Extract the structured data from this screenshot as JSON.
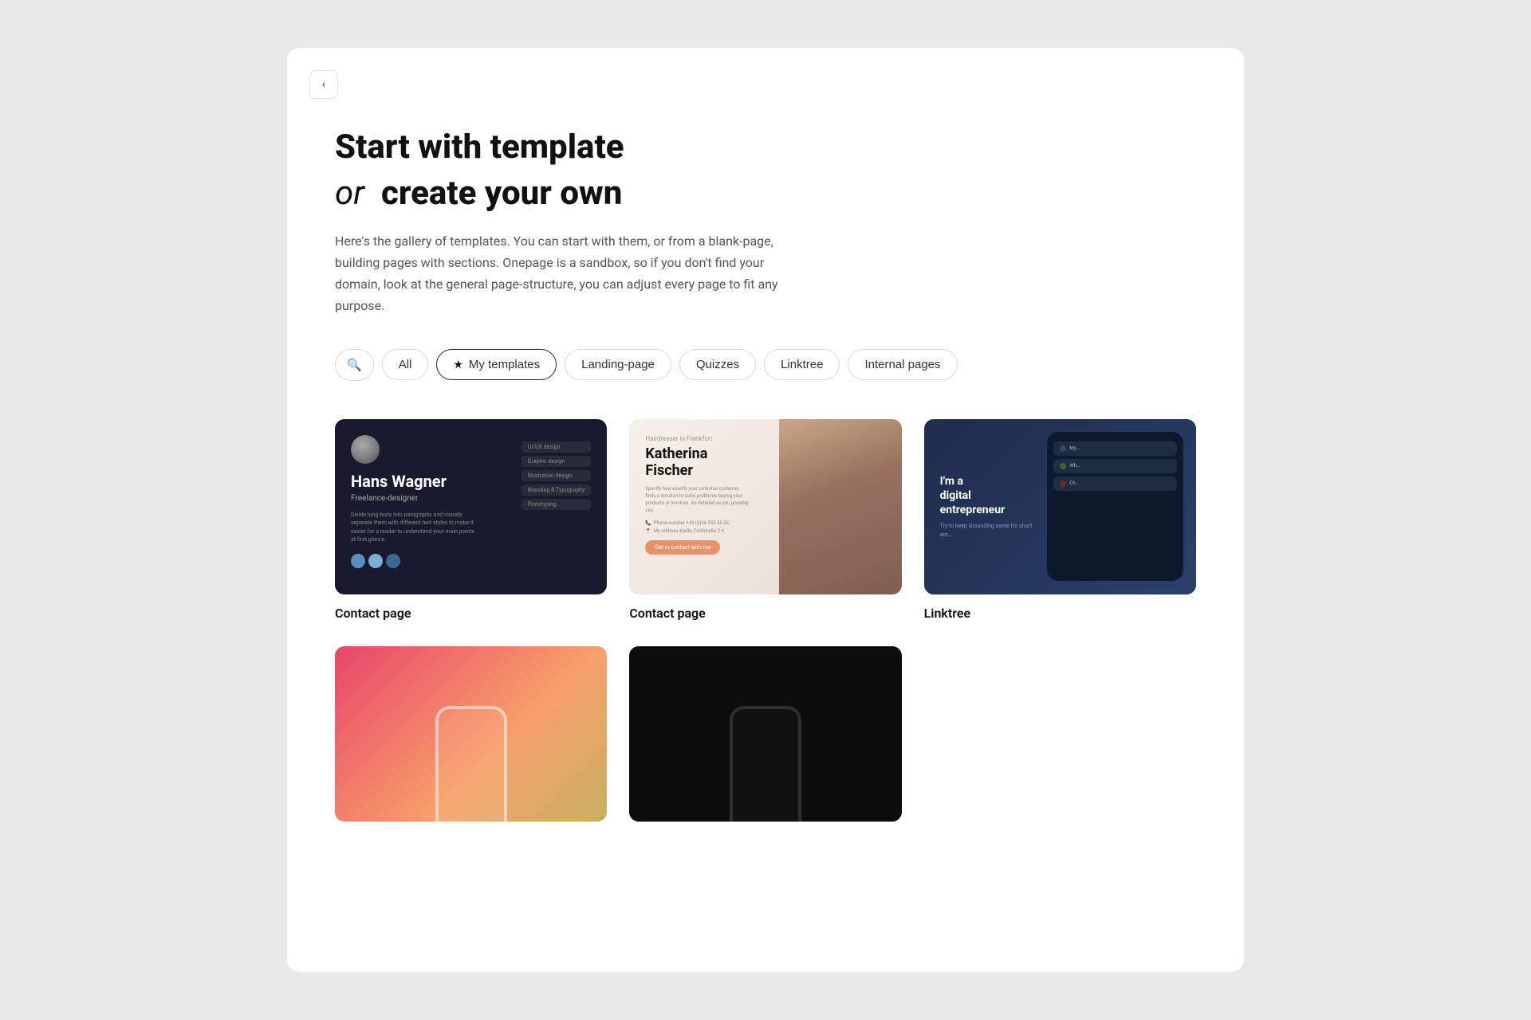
{
  "page": {
    "background_color": "#e8e8e8"
  },
  "header": {
    "back_button_label": "‹"
  },
  "hero": {
    "title_line1": "Start with template",
    "title_line2_italic": "or",
    "title_line2_bold": "create your own",
    "description": "Here's the gallery of templates. You can start with them, or from a blank-page, building pages with sections. Onepage is a sandbox, so if you don't find your domain, look at the general page-structure, you can adjust every page to fit any purpose."
  },
  "filters": {
    "search_placeholder": "Search",
    "items": [
      {
        "id": "search",
        "label": "",
        "icon": "🔍",
        "is_search": true
      },
      {
        "id": "all",
        "label": "All",
        "active": false
      },
      {
        "id": "my-templates",
        "label": "My templates",
        "has_star": true,
        "active": true
      },
      {
        "id": "landing-page",
        "label": "Landing-page",
        "active": false
      },
      {
        "id": "quizzes",
        "label": "Quizzes",
        "active": false
      },
      {
        "id": "linktree",
        "label": "Linktree",
        "active": false
      },
      {
        "id": "internal-pages",
        "label": "Internal pages",
        "active": false
      }
    ]
  },
  "templates": {
    "items": [
      {
        "id": "contact-1",
        "label": "Contact page",
        "theme": "dark",
        "person_name": "Hans Wagner",
        "person_role": "Freelance-designer",
        "skills": [
          "UI/UX design",
          "Graphic design",
          "Illustration design",
          "Branding & Typography",
          "Prototyping"
        ]
      },
      {
        "id": "contact-2",
        "label": "Contact page",
        "theme": "hairdresser",
        "business_type": "Hairdresser in Frankfurt",
        "person_name": "Katherina Fischer",
        "cta": "Get in contact with me"
      },
      {
        "id": "linktree-1",
        "label": "Linktree",
        "theme": "blue",
        "headline": "I'm a digital entrepreneur",
        "subtext": "Try to keep Grounding same for short am...",
        "links": [
          "My...",
          "Wh..."
        ]
      },
      {
        "id": "bottom-1",
        "label": "",
        "theme": "gradient-phone"
      },
      {
        "id": "bottom-2",
        "label": "",
        "theme": "dark-phone"
      }
    ]
  }
}
